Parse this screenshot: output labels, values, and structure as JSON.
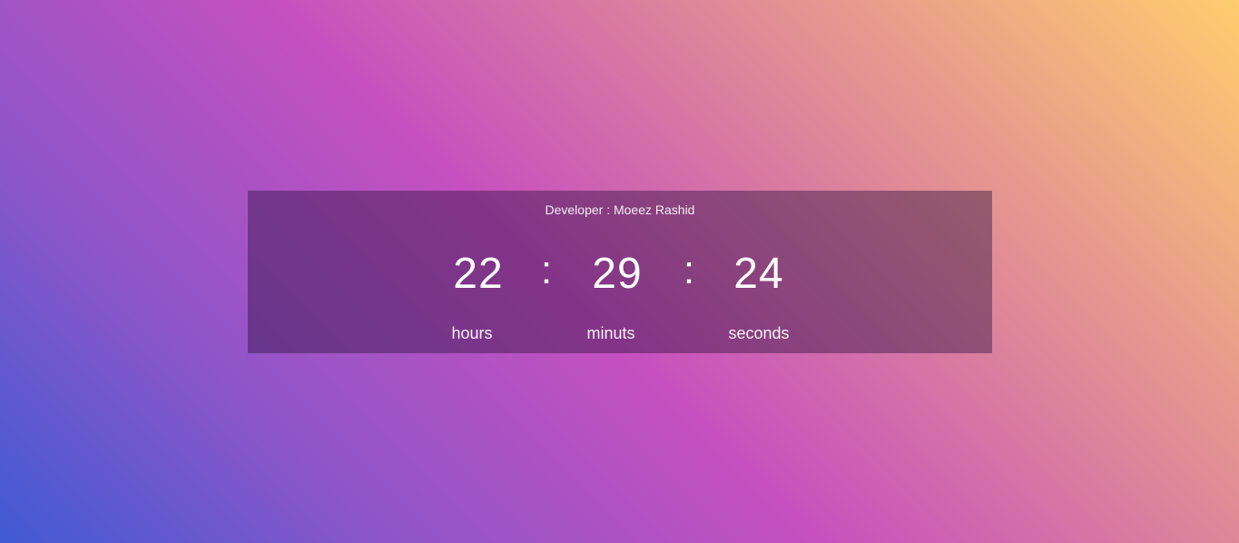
{
  "credit": {
    "text": "Developer : Moeez Rashid"
  },
  "clock": {
    "hours": "22",
    "minutes": "29",
    "seconds": "24",
    "separator": ":"
  },
  "labels": {
    "hours": "hours",
    "minutes": "minuts",
    "seconds": "seconds"
  },
  "colors": {
    "gradient": [
      "#3f5bd4",
      "#8e55c8",
      "#c650bf",
      "#df8898",
      "#ffcc6e"
    ],
    "panel": "rgba(40, 15, 60, 0.42)",
    "text": "#ffffff"
  }
}
